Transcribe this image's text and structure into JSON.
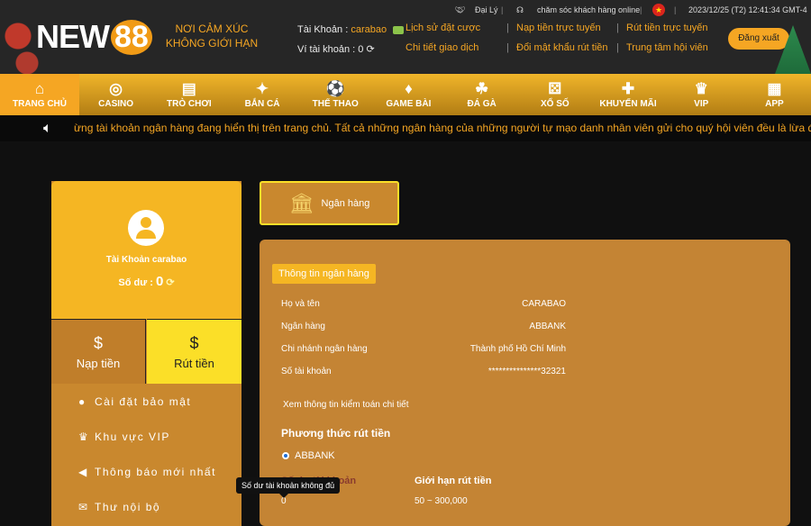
{
  "header": {
    "logo_text": "NEW",
    "logo_number": "88",
    "slogan_line1": "NƠI CẢM XÚC",
    "slogan_line2": "KHÔNG GIỚI HẠN",
    "account_label": "Tài Khoản :",
    "account_user": "carabao",
    "wallet_label": "Ví tài khoản : 0",
    "links": {
      "bet_history": "Lịch sử đặt cược",
      "transactions": "Chi tiết giao dịch",
      "deposit_online": "Nạp tiền trực tuyến",
      "change_password": "Đổi mật khẩu rút tiền",
      "withdraw_online": "Rút tiền trực tuyến",
      "member_center": "Trung tâm hội viên"
    },
    "top": {
      "agent": "Đại Lý",
      "support": "chăm sóc khách hàng online",
      "datetime": "2023/12/25 (T2) 12:41:34 GMT-4"
    },
    "logout": "Đăng xuất"
  },
  "nav": [
    {
      "label": "TRANG CHỦ",
      "icon": "home-icon",
      "glyph": "⌂"
    },
    {
      "label": "CASINO",
      "icon": "casino-chip-icon",
      "glyph": "◎"
    },
    {
      "label": "TRÒ CHƠI",
      "icon": "slot-icon",
      "glyph": "▤"
    },
    {
      "label": "BẮN CÁ",
      "icon": "fish-icon",
      "glyph": "✦"
    },
    {
      "label": "THỂ THAO",
      "icon": "ball-icon",
      "glyph": "⚽"
    },
    {
      "label": "GAME BÀI",
      "icon": "cards-icon",
      "glyph": "♦"
    },
    {
      "label": "ĐÁ GÀ",
      "icon": "rooster-icon",
      "glyph": "☘"
    },
    {
      "label": "XỔ SỐ",
      "icon": "lottery-icon",
      "glyph": "⚄"
    },
    {
      "label": "KHUYẾN MÃI",
      "icon": "gift-icon",
      "glyph": "✚"
    },
    {
      "label": "VIP",
      "icon": "vip-icon",
      "glyph": "♛"
    },
    {
      "label": "APP",
      "icon": "app-grid-icon",
      "glyph": "▦"
    }
  ],
  "marquee": "ừng tài khoản ngân hàng đang hiển thị trên trang chủ. Tất cả những ngân hàng của những người tự mạo danh nhân viên gửi cho quý hội viên đều là lừa đả",
  "sidebar": {
    "profile_name": "Tài Khoản carabao",
    "balance_label": "Số dư :",
    "balance_value": "0",
    "deposit": "Nạp tiền",
    "withdraw": "Rút tiền",
    "menu": [
      "Cài đặt bảo mật",
      "Khu vực VIP",
      "Thông báo mới nhất",
      "Thư nội bộ"
    ]
  },
  "main": {
    "tab": "Ngân hàng",
    "section_title": "Thông tin ngân hàng",
    "fields": [
      {
        "label": "Họ và tên",
        "value": "CARABAO"
      },
      {
        "label": "Ngân hàng",
        "value": "ABBANK"
      },
      {
        "label": "Chi nhánh ngân hàng",
        "value": "Thành phố Hồ Chí Minh"
      },
      {
        "label": "Số tài khoản",
        "value": "***************32321"
      }
    ],
    "audit_link": "Xem thông tin kiểm toán chi tiết",
    "method_title": "Phương thức rút tiền",
    "method_option": "ABBANK",
    "balance_header": "Số dư tài khoản",
    "limit_header": "Giới hạn rút tiền",
    "balance_value": "0",
    "limit_value": "50 ~ 300,000",
    "tooltip": "Số dư tài khoản không đủ"
  }
}
